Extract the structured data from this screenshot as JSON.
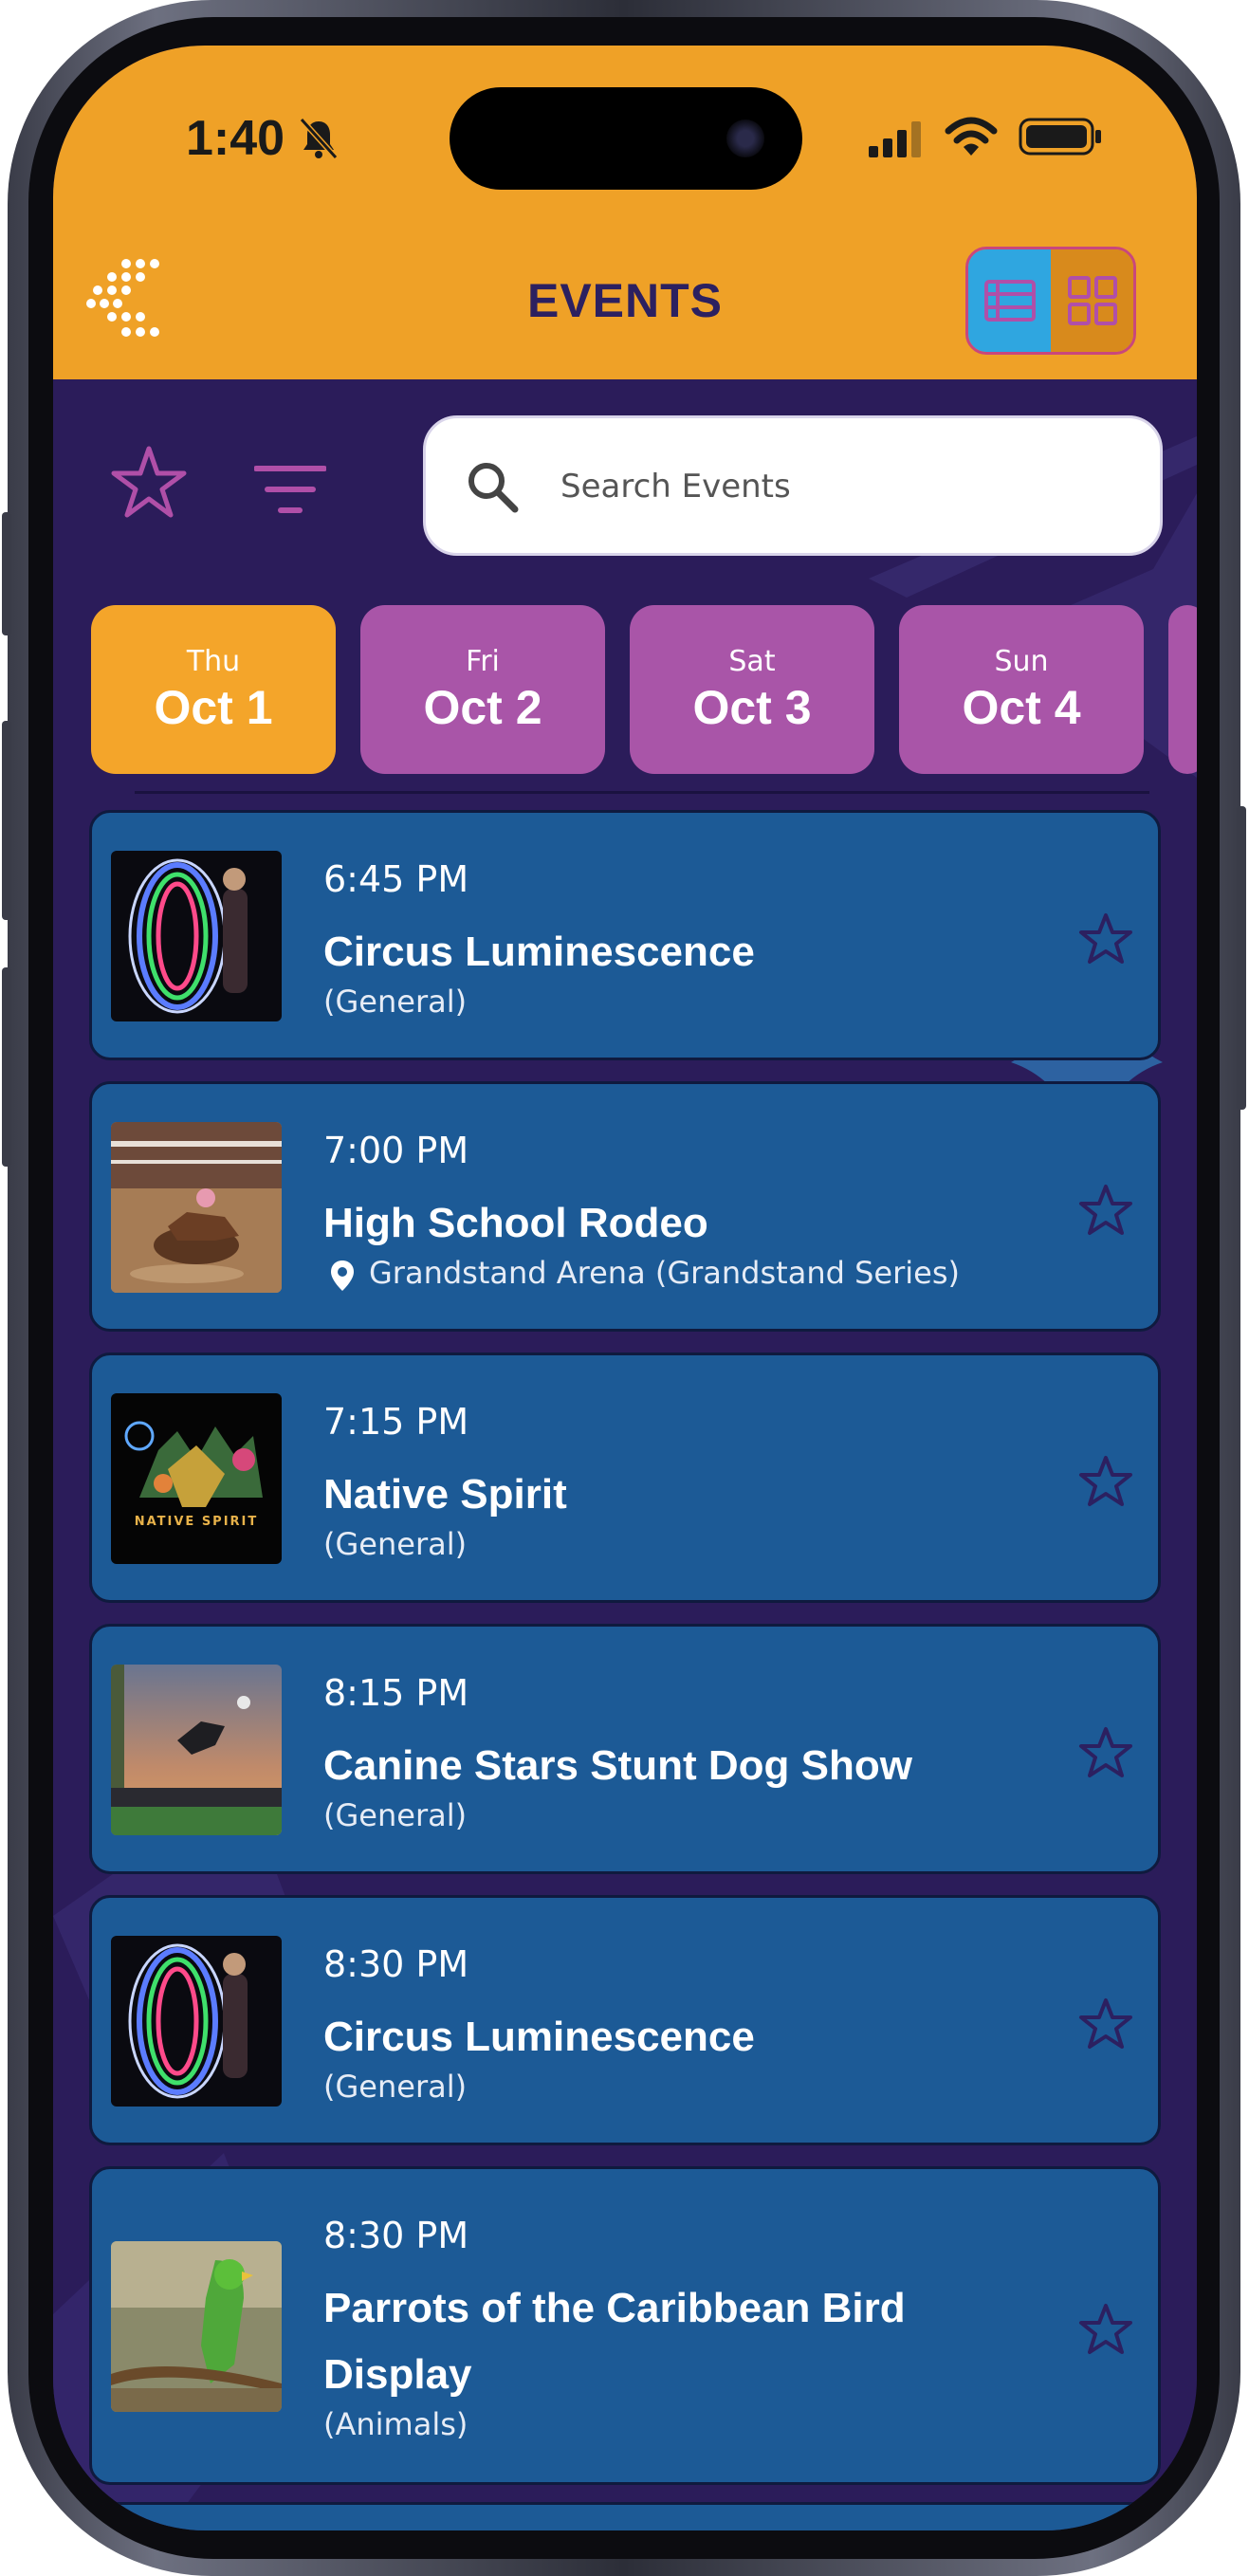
{
  "status_bar": {
    "time": "1:40"
  },
  "header": {
    "title": "EVENTS"
  },
  "search": {
    "placeholder": "Search Events"
  },
  "date_tabs": [
    {
      "dow": "Thu",
      "date": "Oct 1"
    },
    {
      "dow": "Fri",
      "date": "Oct 2"
    },
    {
      "dow": "Sat",
      "date": "Oct 3"
    },
    {
      "dow": "Sun",
      "date": "Oct 4"
    }
  ],
  "events": [
    {
      "time": "6:45 PM",
      "title": "Circus Luminescence",
      "subtitle": "(General)"
    },
    {
      "time": "7:00 PM",
      "title": "High School Rodeo",
      "subtitle": "Grandstand Arena (Grandstand Series)"
    },
    {
      "time": "7:15 PM",
      "title": "Native Spirit",
      "subtitle": "(General)",
      "thumb_text": "NATIVE SPIRIT"
    },
    {
      "time": "8:15 PM",
      "title": "Canine Stars Stunt Dog Show",
      "subtitle": "(General)"
    },
    {
      "time": "8:30 PM",
      "title": "Circus Luminescence",
      "subtitle": "(General)"
    },
    {
      "time": "8:30 PM",
      "title": "Parrots of the Caribbean Bird Display",
      "subtitle": "(Animals)"
    }
  ],
  "colors": {
    "header_bg": "#efa127",
    "page_bg": "#2b1c5a",
    "card_bg": "#1c5a96",
    "tab_active": "#f4a52a",
    "tab_inactive": "#a955a8",
    "accent_pink": "#b04fa8"
  },
  "icons": [
    "bell-slash-icon",
    "signal-icon",
    "wifi-icon",
    "battery-icon",
    "logo-icon",
    "list-view-icon",
    "grid-view-icon",
    "star-icon",
    "filter-icon",
    "search-icon",
    "location-pin-icon"
  ]
}
